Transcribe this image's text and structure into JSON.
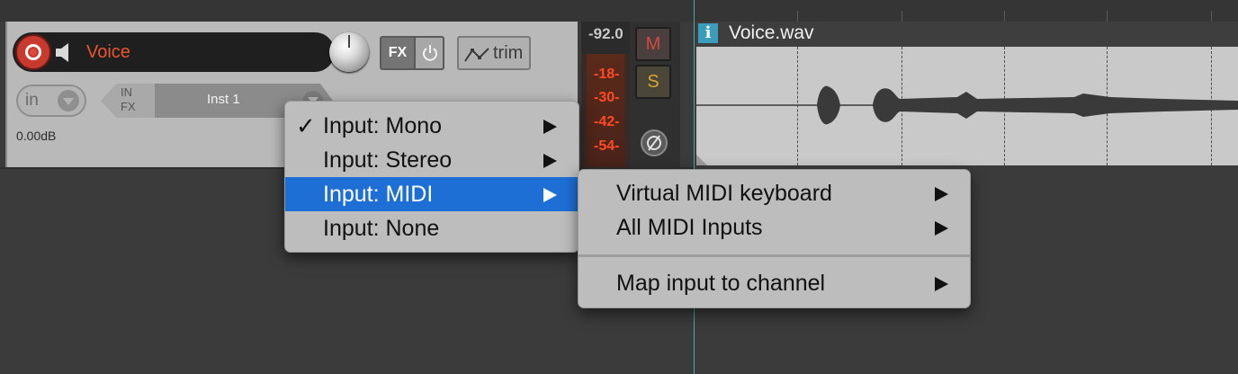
{
  "track": {
    "name": "Voice",
    "volume_db": "0.00dB",
    "input_label": "in",
    "fx_label": "FX",
    "trim_label": "trim",
    "in_fx_label_top": "IN",
    "in_fx_label_bottom": "FX",
    "instrument": "Inst 1",
    "name_color": "#e8562e"
  },
  "meter": {
    "peak": "-92.0",
    "scale": [
      "-18-",
      "-30-",
      "-42-",
      "-54-"
    ]
  },
  "buttons": {
    "mute": "M",
    "solo": "S"
  },
  "item": {
    "info_icon": "i",
    "name": "Voice.wav"
  },
  "menu": {
    "items": [
      {
        "label": "Input: Mono",
        "checked": true,
        "submenu": true
      },
      {
        "label": "Input: Stereo",
        "checked": false,
        "submenu": true
      },
      {
        "label": "Input: MIDI",
        "checked": false,
        "submenu": true,
        "highlighted": true
      },
      {
        "label": "Input: None",
        "checked": false,
        "submenu": false
      }
    ],
    "check_glyph": "✓"
  },
  "submenu": {
    "items": [
      {
        "label": "Virtual MIDI keyboard",
        "submenu": true
      },
      {
        "label": "All MIDI Inputs",
        "submenu": true
      },
      {
        "label": "Map input to channel",
        "submenu": true
      }
    ]
  },
  "colors": {
    "highlight": "#1d6fd6",
    "record": "#c8392e",
    "meter_text": "#ff4a24"
  }
}
